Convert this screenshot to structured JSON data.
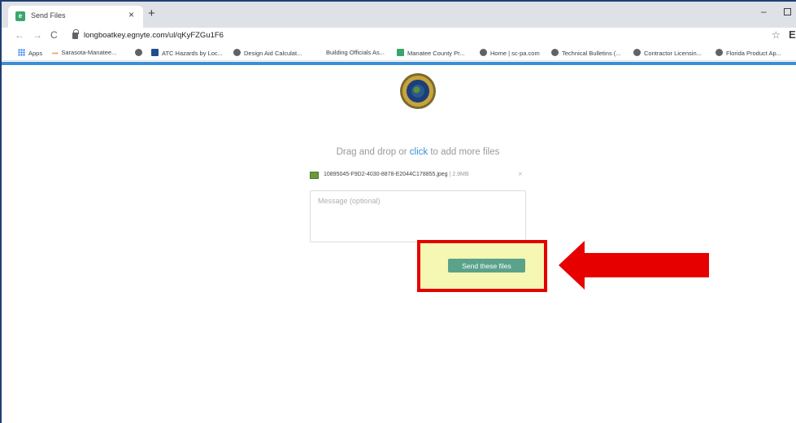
{
  "browser": {
    "tab": {
      "title": "Send Files",
      "favicon": "egnyte-favicon",
      "close_glyph": "×"
    },
    "new_tab_glyph": "+",
    "window": {
      "minimize_glyph": "–"
    },
    "nav": {
      "back_glyph": "←",
      "forward_glyph": "→",
      "reload_glyph": "C"
    },
    "url": "longboatkey.egnyte.com/ul/qKyFZGu1F6",
    "star_glyph": "☆",
    "profile_glyph": "E"
  },
  "bookmarks": [
    {
      "label": "Apps",
      "icon": "apps-grid-icon"
    },
    {
      "label": "Sarasota-Manatee...",
      "icon": "dots-icon"
    },
    {
      "label": "",
      "icon": "globe-icon"
    },
    {
      "label": "ATC Hazards by Loc...",
      "icon": "atc-icon"
    },
    {
      "label": "Design Aid Calculat...",
      "icon": "calc-icon"
    },
    {
      "label": "Building Officials As...",
      "icon": ""
    },
    {
      "label": "Manatee County Pr...",
      "icon": "county-icon"
    },
    {
      "label": "Home | sc-pa.com",
      "icon": "globe-icon"
    },
    {
      "label": "Technical Bulletins (...",
      "icon": "bulletin-icon"
    },
    {
      "label": "Contractor Licensin...",
      "icon": "globe-icon"
    },
    {
      "label": "Florida Product Ap...",
      "icon": "globe-icon"
    }
  ],
  "upload": {
    "drop_prefix": "Drag and drop or ",
    "drop_link": "click",
    "drop_suffix": " to add more files",
    "file": {
      "name": "10895045-F9D2-4030-8878-E2044C178855.jpeg",
      "separator": " | ",
      "size": "2.9MB",
      "remove_glyph": "×"
    },
    "message_placeholder": "Message (optional)",
    "send_label": "Send these files"
  },
  "colors": {
    "accent_bar": "#3a8fd6",
    "send_button": "#5aa38a",
    "highlight_border": "#e60000",
    "highlight_fill": "#f5f7b3",
    "arrow": "#e60000"
  }
}
